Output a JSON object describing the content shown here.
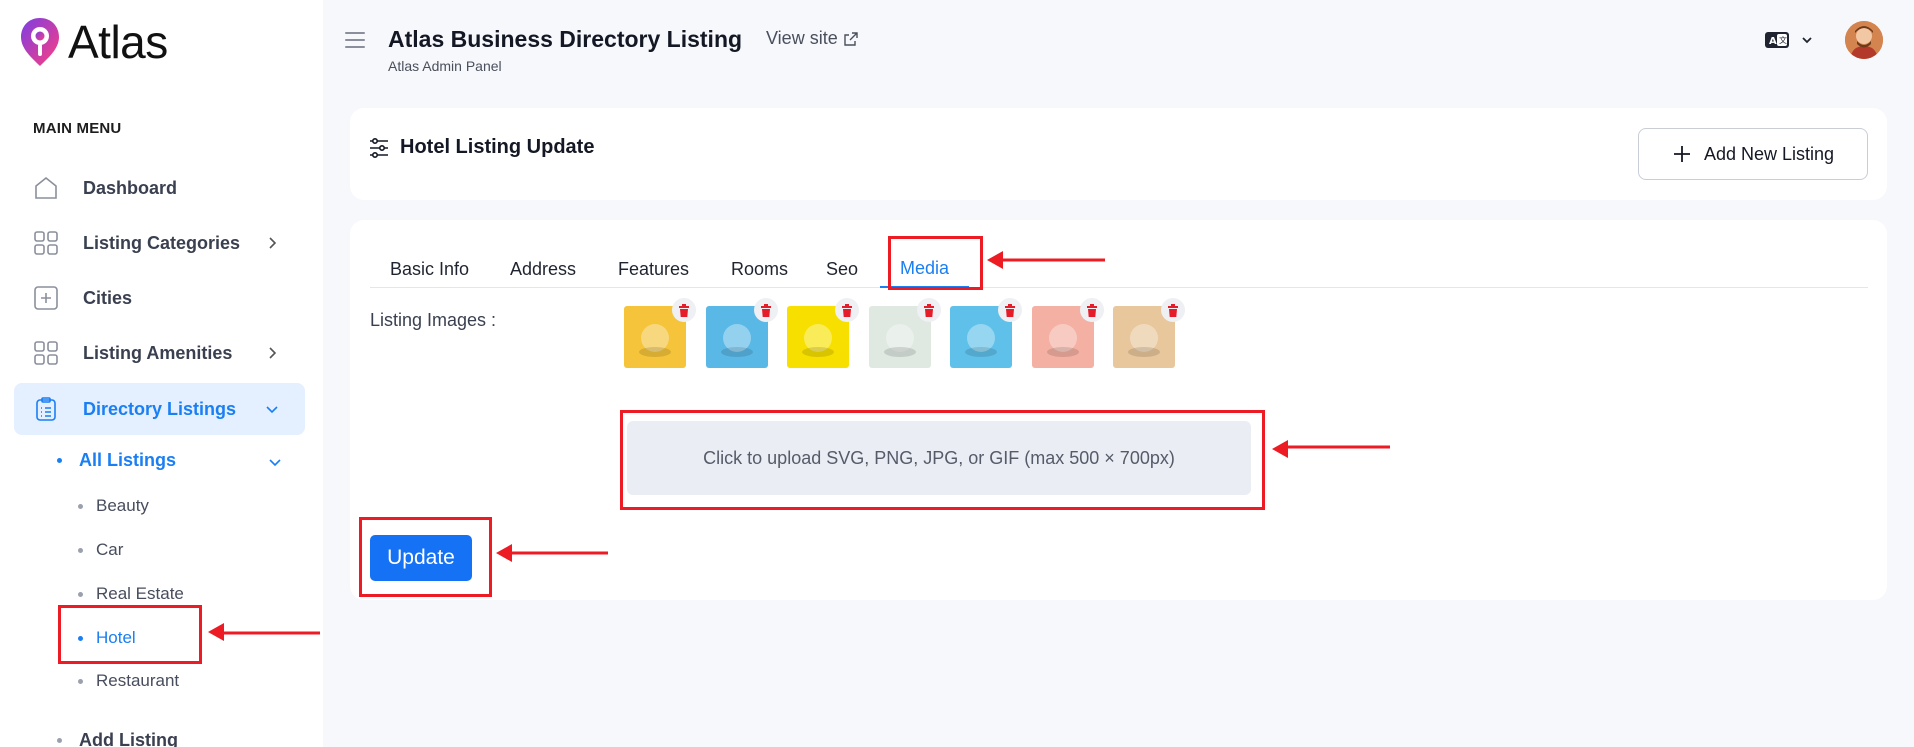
{
  "brand": {
    "name": "Atlas"
  },
  "sidebar": {
    "menu_title": "MAIN MENU",
    "items": [
      {
        "label": "Dashboard",
        "icon": "home-icon"
      },
      {
        "label": "Listing Categories",
        "icon": "grid-icon"
      },
      {
        "label": "Cities",
        "icon": "plus-square-icon"
      },
      {
        "label": "Listing Amenities",
        "icon": "grid-icon"
      },
      {
        "label": "Directory Listings",
        "icon": "clipboard-icon"
      }
    ],
    "sub": {
      "all_listings": "All Listings",
      "add_listing": "Add Listing",
      "leaves": [
        "Beauty",
        "Car",
        "Real Estate",
        "Hotel",
        "Restaurant"
      ]
    }
  },
  "header": {
    "title": "Atlas Business Directory Listing",
    "subtitle": "Atlas Admin Panel",
    "view_site": "View site"
  },
  "card": {
    "title": "Hotel Listing Update",
    "add_button": "Add New Listing"
  },
  "tabs": [
    "Basic Info",
    "Address",
    "Features",
    "Rooms",
    "Seo",
    "Media"
  ],
  "active_tab": "Media",
  "media": {
    "label": "Listing Images :",
    "upload_text": "Click to upload SVG, PNG, JPG, or GIF (max 500 × 700px)",
    "thumb_colors": [
      "#f5c43a",
      "#5ab8e6",
      "#f7e000",
      "#dfe9e2",
      "#5fc1ea",
      "#f4b0a2",
      "#e9c79c"
    ]
  },
  "update_button": "Update",
  "colors": {
    "accent": "#1a7ff2",
    "highlight": "#ec1b24",
    "button": "#1572f5"
  }
}
